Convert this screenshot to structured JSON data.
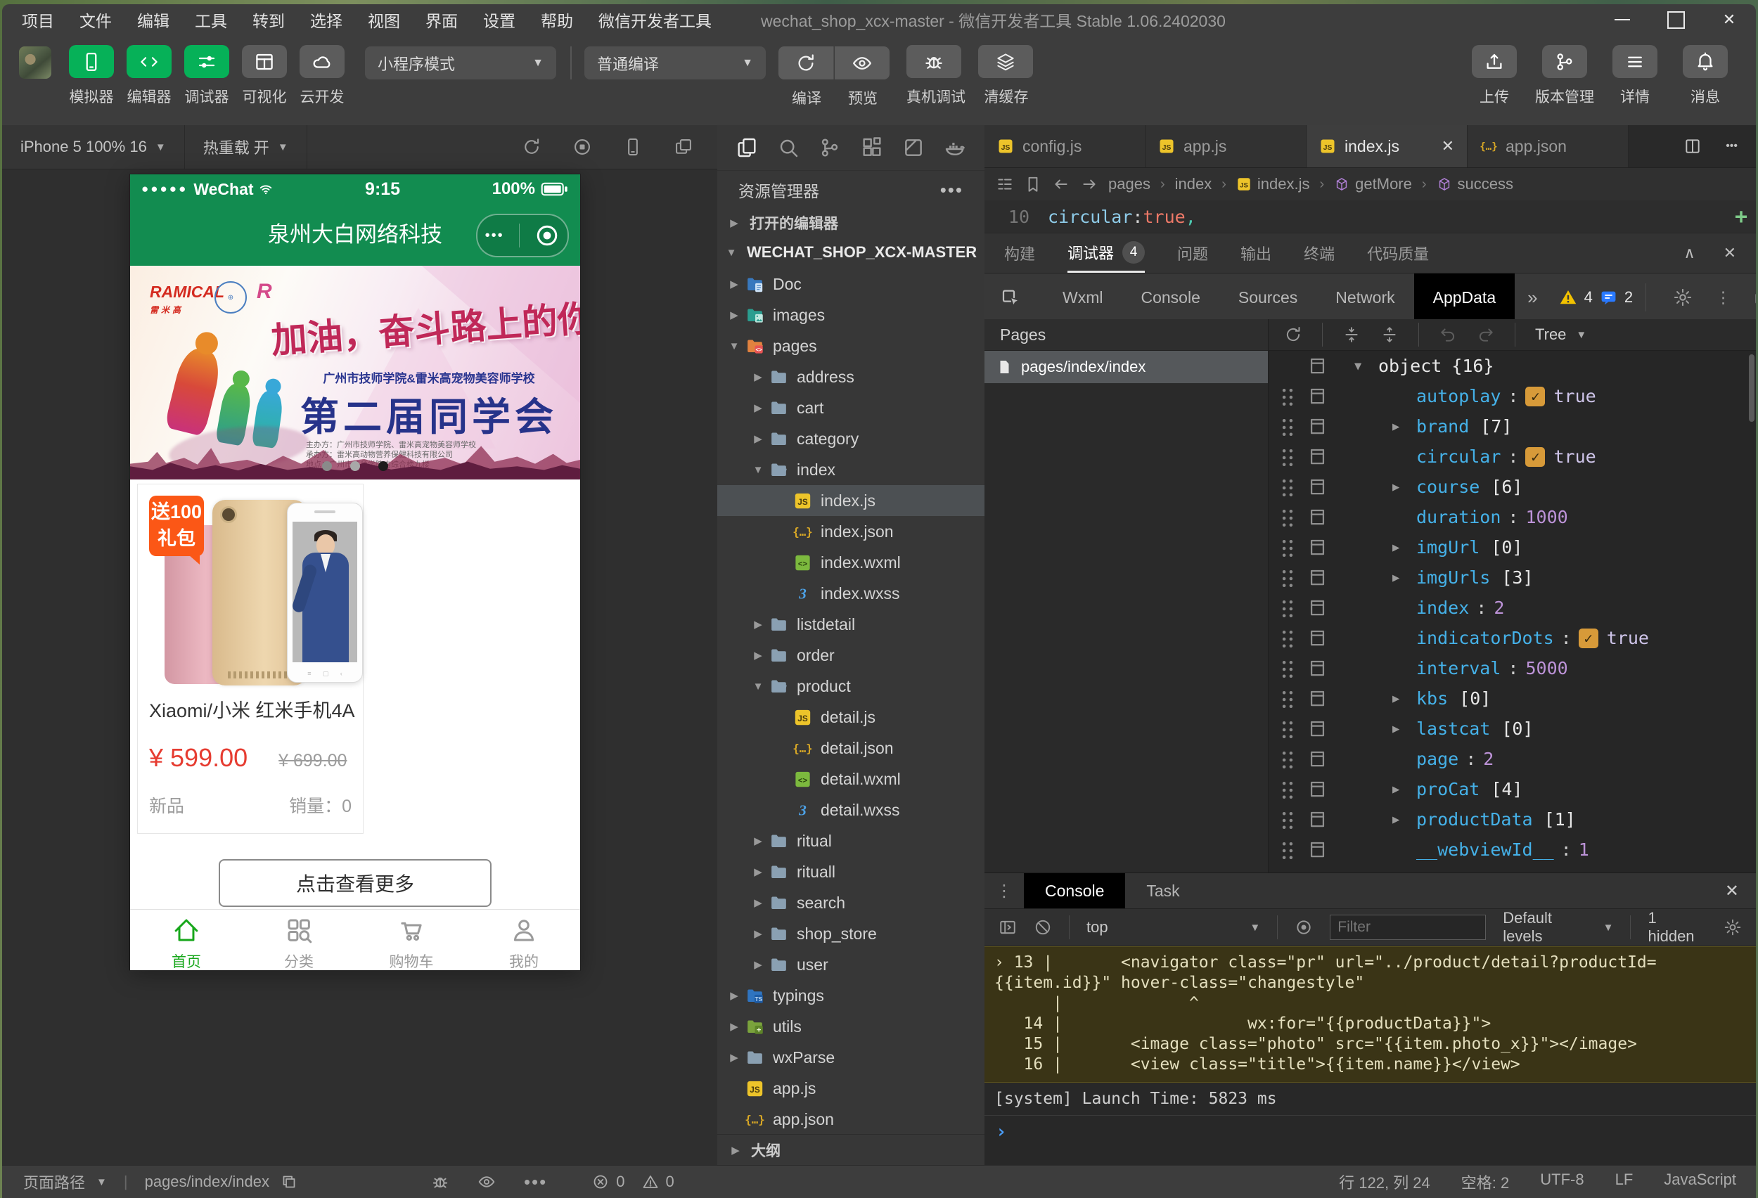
{
  "window": {
    "title": "wechat_shop_xcx-master - 微信开发者工具 Stable 1.06.2402030",
    "controls": [
      "minimize",
      "maximize",
      "close"
    ]
  },
  "menu": [
    "项目",
    "文件",
    "编辑",
    "工具",
    "转到",
    "选择",
    "视图",
    "界面",
    "设置",
    "帮助",
    "微信开发者工具"
  ],
  "toolbar": {
    "left_buttons": [
      {
        "label": "模拟器",
        "icon": "phone-device",
        "style": "green"
      },
      {
        "label": "编辑器",
        "icon": "code",
        "style": "green"
      },
      {
        "label": "调试器",
        "icon": "sliders",
        "style": "green"
      },
      {
        "label": "可视化",
        "icon": "layout",
        "style": "gray"
      },
      {
        "label": "云开发",
        "icon": "cloud",
        "style": "gray"
      }
    ],
    "mode_select": "小程序模式",
    "compile_select": "普通编译",
    "action_buttons": [
      {
        "label": "编译",
        "icon": "compile"
      },
      {
        "label": "预览",
        "icon": "eye"
      }
    ],
    "action_buttons_solo": [
      {
        "label": "真机调试",
        "icon": "bug"
      },
      {
        "label": "清缓存",
        "icon": "layers"
      }
    ],
    "right_buttons": [
      {
        "label": "上传",
        "icon": "upload"
      },
      {
        "label": "版本管理",
        "icon": "branch"
      },
      {
        "label": "详情",
        "icon": "hamburger"
      },
      {
        "label": "消息",
        "icon": "bell"
      }
    ]
  },
  "simulator": {
    "device_select": "iPhone 5 100% 16",
    "hot_reload": "热重载 开",
    "icons": [
      "refresh",
      "stop",
      "phone-device",
      "screenshot"
    ]
  },
  "phone": {
    "status_bar": {
      "signal_dots": "●●●●●",
      "carrier": "WeChat",
      "time": "9:15",
      "battery": "100%"
    },
    "nav_title": "泉州大白网络科技",
    "capsule_dots": "•••",
    "banner": {
      "brand": "RAMICAL",
      "brand_sub": "雷米高",
      "badge_r": "R",
      "slogan": "加油，奋斗路上的你！",
      "subtitle": "广州市技师学院&雷米高宠物美容师学校",
      "heading": "第二届同学会",
      "detail_lines": [
        "主办方：广州市技师学院、雷米高宠物美容师学校",
        "承办方：雷米高动物营养保健科技有限公司",
        "地点：广州市技师学院内综合楼九楼"
      ],
      "indicator_colors": [
        "#8a8a8a",
        "#a8a8a8",
        "#1c1c1c"
      ]
    },
    "product": {
      "badge_line1": "送100",
      "badge_line2": "礼包",
      "title": "Xiaomi/小米 红米手机4A",
      "price": "¥ 599.00",
      "original_price": "¥ 699.00",
      "tag": "新品",
      "sales_label": "销量：",
      "sales_value": "0"
    },
    "more_button": "点击查看更多",
    "tabs": [
      {
        "label": "首页",
        "icon": "home",
        "active": true
      },
      {
        "label": "分类",
        "icon": "grid-search",
        "active": false
      },
      {
        "label": "购物车",
        "icon": "cart",
        "active": false
      },
      {
        "label": "我的",
        "icon": "person",
        "active": false
      }
    ]
  },
  "explorer": {
    "activity_icons": [
      "files",
      "search",
      "branch",
      "extensions",
      "snippet",
      "docker"
    ],
    "title": "资源管理器",
    "open_editors": "打开的编辑器",
    "root": "WECHAT_SHOP_XCX-MASTER",
    "outline": "大纲",
    "tree": [
      {
        "n": "Doc",
        "i": "folder-doc",
        "d": 1,
        "a": "closed"
      },
      {
        "n": "images",
        "i": "folder-images",
        "d": 1,
        "a": "closed"
      },
      {
        "n": "pages",
        "i": "folder-pages",
        "d": 1,
        "a": "open"
      },
      {
        "n": "address",
        "i": "folder",
        "d": 2,
        "a": "closed"
      },
      {
        "n": "cart",
        "i": "folder",
        "d": 2,
        "a": "closed"
      },
      {
        "n": "category",
        "i": "folder",
        "d": 2,
        "a": "closed"
      },
      {
        "n": "index",
        "i": "folder-open",
        "d": 2,
        "a": "open"
      },
      {
        "n": "index.js",
        "i": "js",
        "d": 3,
        "sel": true
      },
      {
        "n": "index.json",
        "i": "json",
        "d": 3
      },
      {
        "n": "index.wxml",
        "i": "wxml",
        "d": 3
      },
      {
        "n": "index.wxss",
        "i": "wxss",
        "d": 3
      },
      {
        "n": "listdetail",
        "i": "folder",
        "d": 2,
        "a": "closed"
      },
      {
        "n": "order",
        "i": "folder",
        "d": 2,
        "a": "closed"
      },
      {
        "n": "product",
        "i": "folder-open",
        "d": 2,
        "a": "open"
      },
      {
        "n": "detail.js",
        "i": "js",
        "d": 3
      },
      {
        "n": "detail.json",
        "i": "json",
        "d": 3
      },
      {
        "n": "detail.wxml",
        "i": "wxml",
        "d": 3
      },
      {
        "n": "detail.wxss",
        "i": "wxss",
        "d": 3
      },
      {
        "n": "ritual",
        "i": "folder",
        "d": 2,
        "a": "closed"
      },
      {
        "n": "rituall",
        "i": "folder",
        "d": 2,
        "a": "closed"
      },
      {
        "n": "search",
        "i": "folder",
        "d": 2,
        "a": "closed"
      },
      {
        "n": "shop_store",
        "i": "folder",
        "d": 2,
        "a": "closed"
      },
      {
        "n": "user",
        "i": "folder",
        "d": 2,
        "a": "closed"
      },
      {
        "n": "typings",
        "i": "folder-ts",
        "d": 1,
        "a": "closed"
      },
      {
        "n": "utils",
        "i": "folder-utils",
        "d": 1,
        "a": "closed"
      },
      {
        "n": "wxParse",
        "i": "folder",
        "d": 1,
        "a": "closed"
      },
      {
        "n": "app.js",
        "i": "js",
        "d": 1
      },
      {
        "n": "app.json",
        "i": "json",
        "d": 1
      }
    ]
  },
  "editor": {
    "tabs": [
      {
        "name": "config.js",
        "icon": "js",
        "active": false
      },
      {
        "name": "app.js",
        "icon": "js",
        "active": false
      },
      {
        "name": "index.js",
        "icon": "js",
        "active": true,
        "close": "✕"
      },
      {
        "name": "app.json",
        "icon": "json",
        "active": false
      }
    ],
    "breadcrumb": [
      {
        "label": "pages"
      },
      {
        "label": "index"
      },
      {
        "label": "index.js",
        "icon": "js"
      },
      {
        "label": "getMore",
        "icon": "cube"
      },
      {
        "label": "success",
        "icon": "cube"
      }
    ],
    "line_number": "10",
    "code": {
      "property": "circular",
      "colon": ": ",
      "value": "true",
      "comma": ","
    }
  },
  "panel_tabs": [
    {
      "label": "构建"
    },
    {
      "label": "调试器",
      "badge": "4",
      "active": true
    },
    {
      "label": "问题"
    },
    {
      "label": "输出"
    },
    {
      "label": "终端"
    },
    {
      "label": "代码质量"
    }
  ],
  "devtools": {
    "tabs": [
      {
        "label": "Wxml"
      },
      {
        "label": "Console"
      },
      {
        "label": "Sources"
      },
      {
        "label": "Network"
      },
      {
        "label": "AppData",
        "active": true
      }
    ],
    "overflow": "»",
    "warning_count": "4",
    "info_count": "2",
    "pages": {
      "title": "Pages",
      "items": [
        {
          "path": "pages/index/index",
          "selected": true
        }
      ]
    },
    "appdata": {
      "view_mode": "Tree",
      "root_label": "object",
      "root_badge": "{16}",
      "entries": [
        {
          "key": "autoplay",
          "type": "bool",
          "value": "true"
        },
        {
          "key": "brand",
          "type": "array",
          "value": "[7]"
        },
        {
          "key": "circular",
          "type": "bool",
          "value": "true"
        },
        {
          "key": "course",
          "type": "array",
          "value": "[6]"
        },
        {
          "key": "duration",
          "type": "number",
          "value": "1000"
        },
        {
          "key": "imgUrl",
          "type": "array",
          "value": "[0]"
        },
        {
          "key": "imgUrls",
          "type": "array",
          "value": "[3]"
        },
        {
          "key": "index",
          "type": "number",
          "value": "2"
        },
        {
          "key": "indicatorDots",
          "type": "bool",
          "value": "true"
        },
        {
          "key": "interval",
          "type": "number",
          "value": "5000"
        },
        {
          "key": "kbs",
          "type": "array",
          "value": "[0]"
        },
        {
          "key": "lastcat",
          "type": "array",
          "value": "[0]"
        },
        {
          "key": "page",
          "type": "number",
          "value": "2"
        },
        {
          "key": "proCat",
          "type": "array",
          "value": "[4]"
        },
        {
          "key": "productData",
          "type": "array",
          "value": "[1]"
        },
        {
          "key": "__webviewId__",
          "type": "number",
          "value": "1"
        }
      ]
    }
  },
  "console": {
    "tabs": [
      {
        "label": "Console",
        "active": true
      },
      {
        "label": "Task",
        "active": false
      }
    ],
    "context": "top",
    "filter_placeholder": "Filter",
    "levels": "Default levels",
    "hidden": "1 hidden",
    "warning_lines": [
      "› 13 |       <navigator class=\"pr\" url=\"../product/detail?productId=",
      "{{item.id}}\" hover-class=\"changestyle\"",
      "      |             ^",
      "   14 |                   wx:for=\"{{productData}}\">",
      "   15 |       <image class=\"photo\" src=\"{{item.photo_x}}\"></image>",
      "   16 |       <view class=\"title\">{{item.name}}</view>"
    ],
    "system_line": "[system] Launch Time: 5823 ms",
    "prompt": "›"
  },
  "statusbar": {
    "page_path_label": "页面路径",
    "page_path": "pages/index/index",
    "errors": "0",
    "warnings": "0",
    "right": [
      "行 122, 列 24",
      "空格: 2",
      "UTF-8",
      "LF",
      "JavaScript"
    ]
  }
}
